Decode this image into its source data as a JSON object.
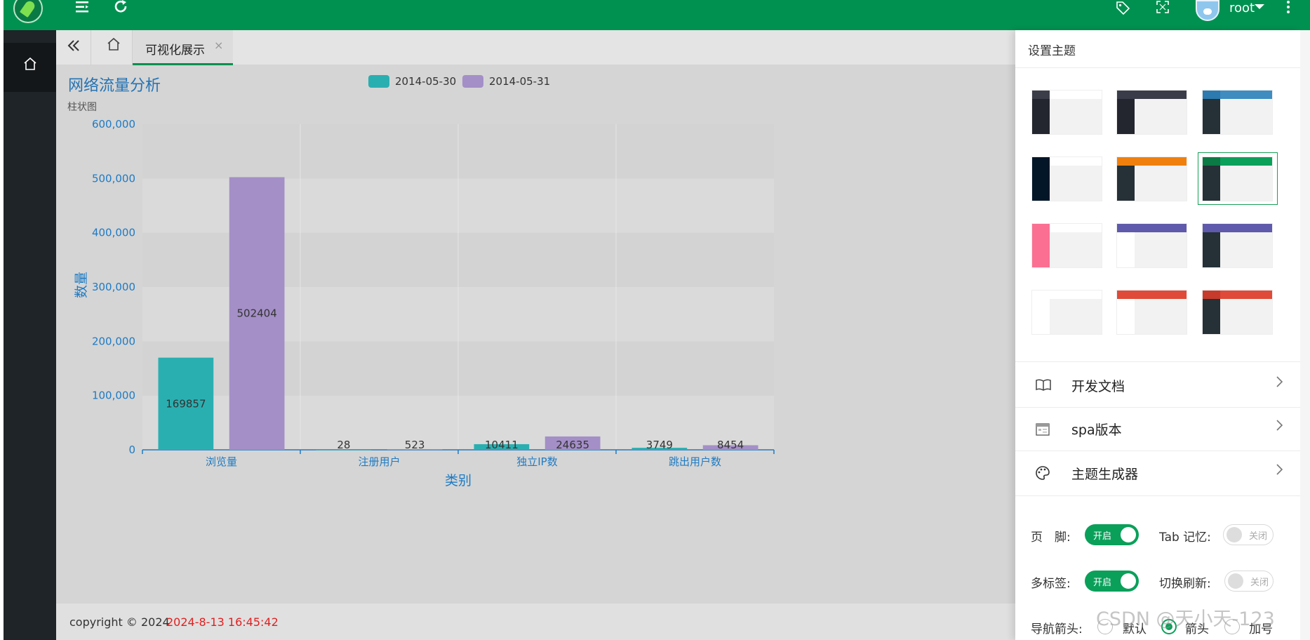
{
  "header": {
    "user": "root",
    "icons": [
      "logo",
      "menu-fold-icon",
      "refresh-icon",
      "tag-icon",
      "fullscreen-icon",
      "avatar",
      "more-icon"
    ]
  },
  "sidebar": {
    "items": [
      {
        "icon": "home-icon"
      }
    ]
  },
  "tabs": {
    "items": [
      {
        "label": "可视化展示",
        "active": true
      }
    ],
    "close_glyph": "×"
  },
  "chart_data": {
    "type": "bar",
    "title": "网络流量分析",
    "subtitle": "柱状图",
    "xlabel": "类别",
    "ylabel": "数量",
    "categories": [
      "浏览量",
      "注册用户",
      "独立IP数",
      "跳出用户数"
    ],
    "series": [
      {
        "name": "2014-05-30",
        "color": "#2aafb1",
        "values": [
          169857,
          28,
          10411,
          3749
        ]
      },
      {
        "name": "2014-05-31",
        "color": "#a48fc7",
        "values": [
          502404,
          523,
          24635,
          8454
        ]
      }
    ],
    "ylim": [
      0,
      600000
    ],
    "yticks": [
      "0",
      "100,000",
      "200,000",
      "300,000",
      "400,000",
      "500,000",
      "600,000"
    ],
    "legend_position": "top-center",
    "grid": true,
    "axis_color": "#1e7bc4"
  },
  "footer": {
    "copyright": "copyright © 2024",
    "datetime": "2024-8-13 16:45:42"
  },
  "theme_panel": {
    "title": "设置主题",
    "themes": [
      {
        "header": "#ffffff",
        "side": "#23262e",
        "logo": "#3b3e48",
        "selected": false
      },
      {
        "header": "#3a3d49",
        "side": "#23262e",
        "logo": "#3a3d49",
        "selected": false
      },
      {
        "header": "#3e8cc0",
        "side": "#253037",
        "logo": "#2c7aaf",
        "selected": false
      },
      {
        "header": "#ffffff",
        "side": "#021628",
        "logo": "#021628",
        "selected": false
      },
      {
        "header": "#f0800e",
        "side": "#253037",
        "logo": "#f0800e",
        "selected": false
      },
      {
        "header": "#0aa05a",
        "side": "#253037",
        "logo": "#0b7a44",
        "selected": true
      },
      {
        "header": "#ffffff",
        "side": "#fb6f92",
        "logo": "#fb6f92",
        "selected": false
      },
      {
        "header": "#5f5aab",
        "side": "#ffffff",
        "logo": "#5f5aab",
        "selected": false
      },
      {
        "header": "#5f5aab",
        "side": "#253037",
        "logo": "#5f5aab",
        "selected": false
      },
      {
        "header": "#ffffff",
        "side": "#ffffff",
        "logo": "#ffffff",
        "selected": false
      },
      {
        "header": "#e04a38",
        "side": "#ffffff",
        "logo": "#e04a38",
        "selected": false
      },
      {
        "header": "#e04a38",
        "side": "#253037",
        "logo": "#c63b2c",
        "selected": false
      }
    ],
    "menu": [
      {
        "label": "开发文档",
        "icon": "book-icon"
      },
      {
        "label": "spa版本",
        "icon": "calendar-icon"
      },
      {
        "label": "主题生成器",
        "icon": "palette-icon"
      }
    ],
    "settings": {
      "footer_label": "页　脚:",
      "footer_value": "开启",
      "tab_memory_label": "Tab 记忆:",
      "tab_memory_value": "关闭",
      "multi_tab_label": "多标签:",
      "multi_tab_value": "开启",
      "switch_refresh_label": "切换刷新:",
      "switch_refresh_value": "关闭",
      "nav_arrow_label": "导航箭头:",
      "nav_options": [
        "默认",
        "箭头",
        "加号"
      ],
      "nav_selected": "箭头"
    }
  },
  "watermark": "CSDN @天小天-123"
}
